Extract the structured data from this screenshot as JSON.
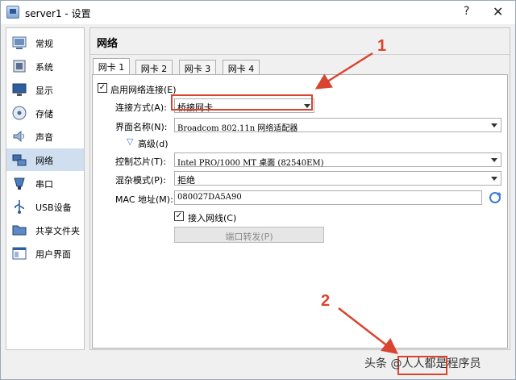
{
  "window": {
    "title": "server1 - 设置",
    "help": "?",
    "close": "✕"
  },
  "sidebar": {
    "items": [
      {
        "label": "常规",
        "icon": "general-icon"
      },
      {
        "label": "系统",
        "icon": "system-icon"
      },
      {
        "label": "显示",
        "icon": "display-icon"
      },
      {
        "label": "存储",
        "icon": "storage-icon"
      },
      {
        "label": "声音",
        "icon": "audio-icon"
      },
      {
        "label": "网络",
        "icon": "network-icon",
        "active": true
      },
      {
        "label": "串口",
        "icon": "serial-port-icon"
      },
      {
        "label": "USB设备",
        "icon": "usb-icon"
      },
      {
        "label": "共享文件夹",
        "icon": "shared-folder-icon"
      },
      {
        "label": "用户界面",
        "icon": "user-interface-icon"
      }
    ]
  },
  "content": {
    "title": "网络",
    "tabs": [
      {
        "label": "网卡 1",
        "active": true
      },
      {
        "label": "网卡 2"
      },
      {
        "label": "网卡 3"
      },
      {
        "label": "网卡 4"
      }
    ],
    "enable_adapter": {
      "label": "启用网络连接(E)",
      "checked": true
    },
    "attached_to": {
      "label": "连接方式(A):",
      "value": "桥接网卡"
    },
    "name": {
      "label": "界面名称(N):",
      "value": "Broadcom 802.11n 网络适配器"
    },
    "advanced": {
      "label": "高级(d)"
    },
    "adapter_type": {
      "label": "控制芯片(T):",
      "value": "Intel PRO/1000 MT 桌面 (82540EM)"
    },
    "promiscuous": {
      "label": "混杂模式(P):",
      "value": "拒绝"
    },
    "mac": {
      "label": "MAC 地址(M):",
      "value": "080027DA5A90"
    },
    "cable_connected": {
      "label": "接入网线(C)",
      "checked": true
    },
    "port_forwarding": {
      "label": "端口转发(P)"
    }
  },
  "annotations": {
    "one": "1",
    "two": "2"
  },
  "watermark": "头条 @人人都是程序员",
  "colors": {
    "annotation": "#d9442f",
    "active_item": "#cfdff0",
    "accent": "#3a7bd5"
  }
}
